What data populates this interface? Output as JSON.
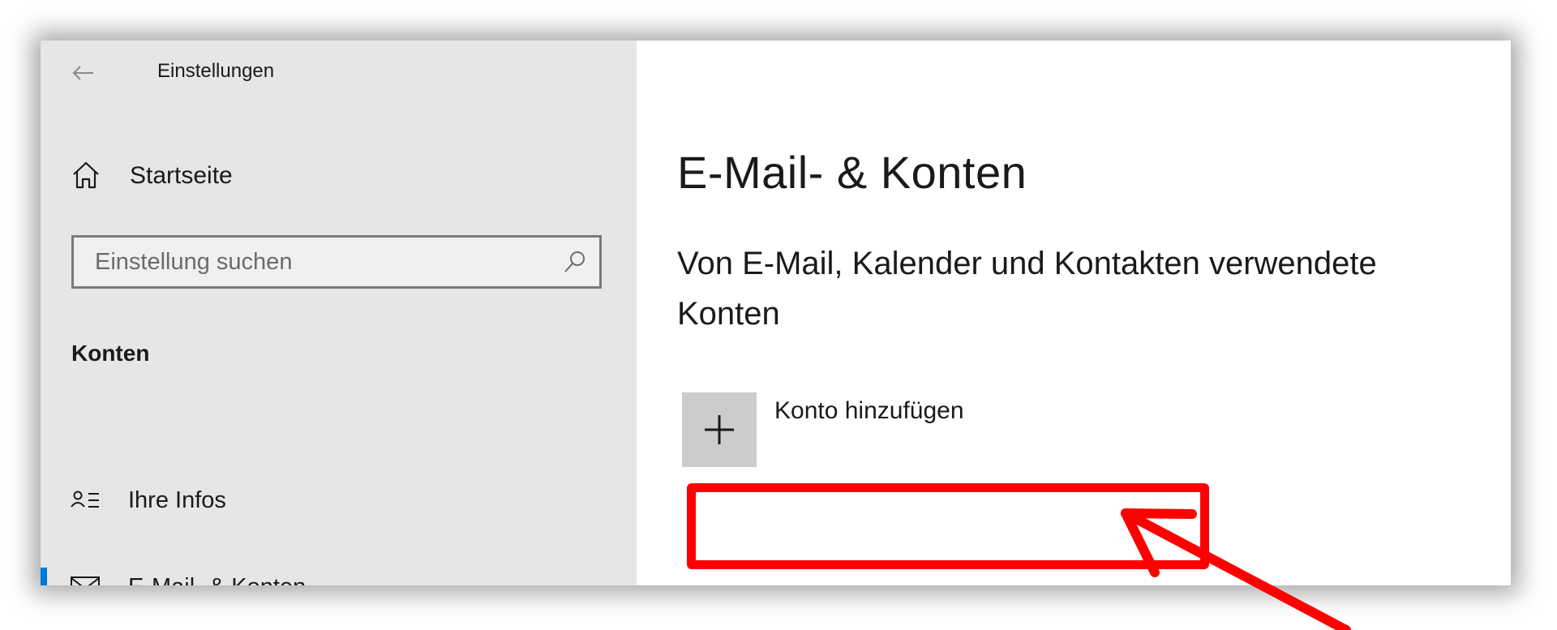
{
  "window": {
    "title": "Einstellungen"
  },
  "sidebar": {
    "home_label": "Startseite",
    "search_placeholder": "Einstellung suchen",
    "section_heading": "Konten",
    "items": [
      {
        "label": "Ihre Infos",
        "icon": "person-list-icon",
        "selected": false
      },
      {
        "label": "E-Mail- & Konten",
        "icon": "mail-icon",
        "selected": true
      }
    ]
  },
  "main": {
    "page_title": "E-Mail- & Konten",
    "section_title": "Von E-Mail, Kalender und Kontakten verwendete Konten",
    "add_account_label": "Konto hinzufügen"
  },
  "annotation": {
    "color": "#ff0000"
  },
  "colors": {
    "accent": "#0078d7",
    "sidebar_bg": "#e6e6e6",
    "tile_bg": "#cccccc"
  }
}
